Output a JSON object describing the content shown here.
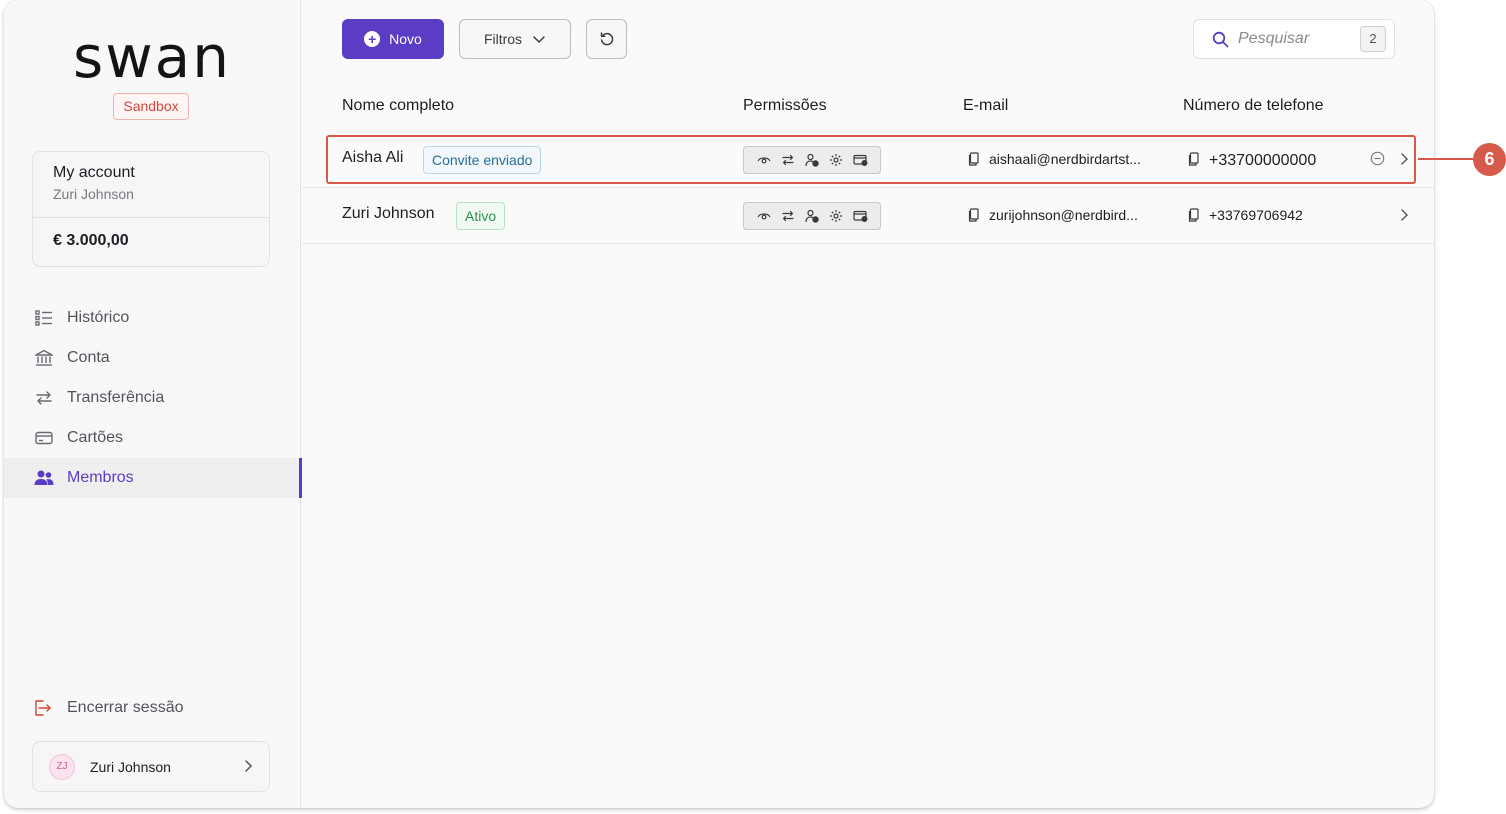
{
  "sidebar": {
    "logo": "swan",
    "environment_badge": "Sandbox",
    "account": {
      "title": "My account",
      "owner": "Zuri Johnson",
      "balance": "€ 3.000,00"
    },
    "nav": [
      {
        "label": "Histórico",
        "icon": "list-icon",
        "active": false
      },
      {
        "label": "Conta",
        "icon": "bank-icon",
        "active": false
      },
      {
        "label": "Transferência",
        "icon": "transfer-arrows-icon",
        "active": false
      },
      {
        "label": "Cartões",
        "icon": "card-icon",
        "active": false
      },
      {
        "label": "Membros",
        "icon": "users-icon",
        "active": true
      }
    ],
    "logout_label": "Encerrar sessão",
    "user": {
      "initials": "ZJ",
      "name": "Zuri Johnson"
    }
  },
  "toolbar": {
    "new_label": "Novo",
    "filters_label": "Filtros",
    "search_placeholder": "Pesquisar",
    "search_count": "2"
  },
  "table": {
    "columns": [
      "Nome completo",
      "Permissões",
      "E-mail",
      "Número de telefone"
    ],
    "rows": [
      {
        "name": "Aisha Ali",
        "status": "Convite enviado",
        "email": "aishaali@nerdbirdartst...",
        "phone": "+33700000000"
      },
      {
        "name": "Zuri Johnson",
        "status": "Ativo",
        "email": "zurijohnson@nerdbird...",
        "phone": "+33769706942"
      }
    ]
  },
  "annotation": {
    "number": "6"
  },
  "colors": {
    "accent": "#5b3cc4",
    "highlight": "#d65a4a",
    "sandbox": "#d4473a"
  }
}
